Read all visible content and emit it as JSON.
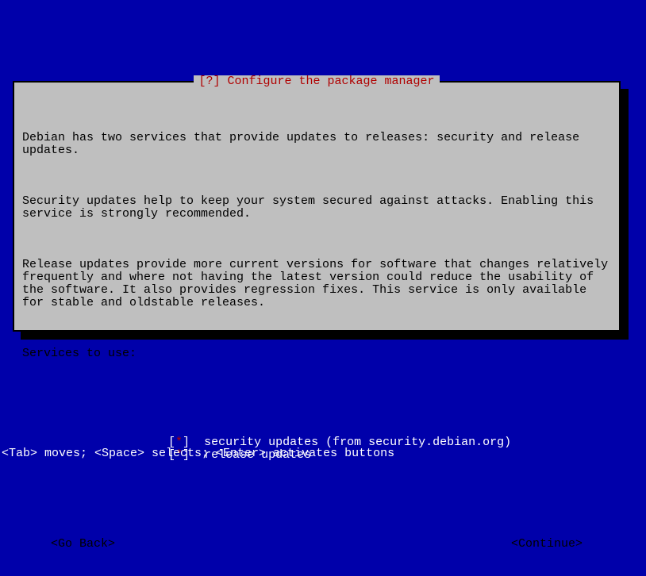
{
  "dialog": {
    "title": "[?] Configure the package manager",
    "para1": "Debian has two services that provide updates to releases: security and release updates.",
    "para2": "Security updates help to keep your system secured against attacks. Enabling this service is strongly recommended.",
    "para3": "Release updates provide more current versions for software that changes relatively frequently and where not having the latest version could reduce the usability of the software. It also provides regression fixes. This service is only available for stable and oldstable releases.",
    "prompt": "Services to use:",
    "options": [
      {
        "checked": true,
        "label": "security updates (from security.debian.org)"
      },
      {
        "checked": true,
        "label": "release updates"
      }
    ],
    "back_label": "<Go Back>",
    "continue_label": "<Continue>"
  },
  "footer": "<Tab> moves; <Space> selects; <Enter> activates buttons"
}
